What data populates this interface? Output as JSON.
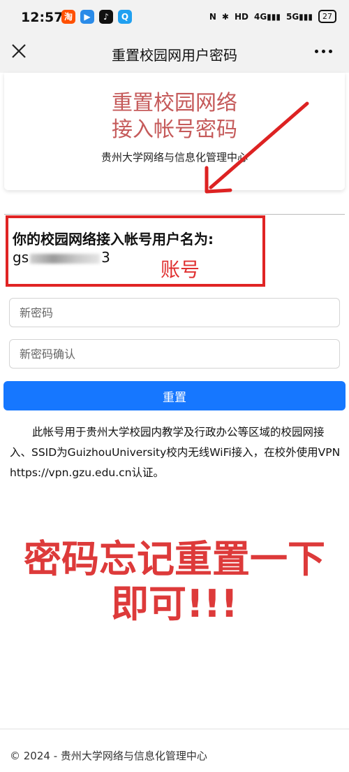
{
  "status_bar": {
    "time": "12:57",
    "apps": [
      {
        "icon": "taobao-icon",
        "glyph": "淘",
        "color": "#ff5000"
      },
      {
        "icon": "video-app-icon",
        "glyph": "▶",
        "color": "#2b8be8"
      },
      {
        "icon": "tiktok-icon",
        "glyph": "♪",
        "color": "#111111"
      },
      {
        "icon": "qq-icon",
        "glyph": "Q",
        "color": "#20a0f0"
      }
    ],
    "indicators": [
      "NFC",
      "bluetooth",
      "HD",
      "4G",
      "5G"
    ],
    "battery": "27"
  },
  "nav": {
    "title": "重置校园网用户密码"
  },
  "header": {
    "title_line1": "重置校园网络",
    "title_line2": "接入帐号密码",
    "subtitle": "贵州大学网络与信息化管理中心"
  },
  "account": {
    "label": "你的校园网络接入帐号用户名为:",
    "value_prefix": "gs",
    "value_suffix": "3",
    "annotation": "账号"
  },
  "form": {
    "new_password_placeholder": "新密码",
    "confirm_password_placeholder": "新密码确认",
    "submit_label": "重置"
  },
  "notice": "此帐号用于贵州大学校园内教学及行政办公等区域的校园网接入、SSID为GuizhouUniversity校内无线WiFi接入，在校外使用VPN https://vpn.gzu.edu.cn认证。",
  "overlay": {
    "line1": "密码忘记重置一下",
    "line2": "即可!!!"
  },
  "footer": "© 2024 - 贵州大学网络与信息化管理中心",
  "colors": {
    "accent": "#1677ff",
    "annotation_red": "#e02424",
    "header_title": "#c55a5a"
  }
}
